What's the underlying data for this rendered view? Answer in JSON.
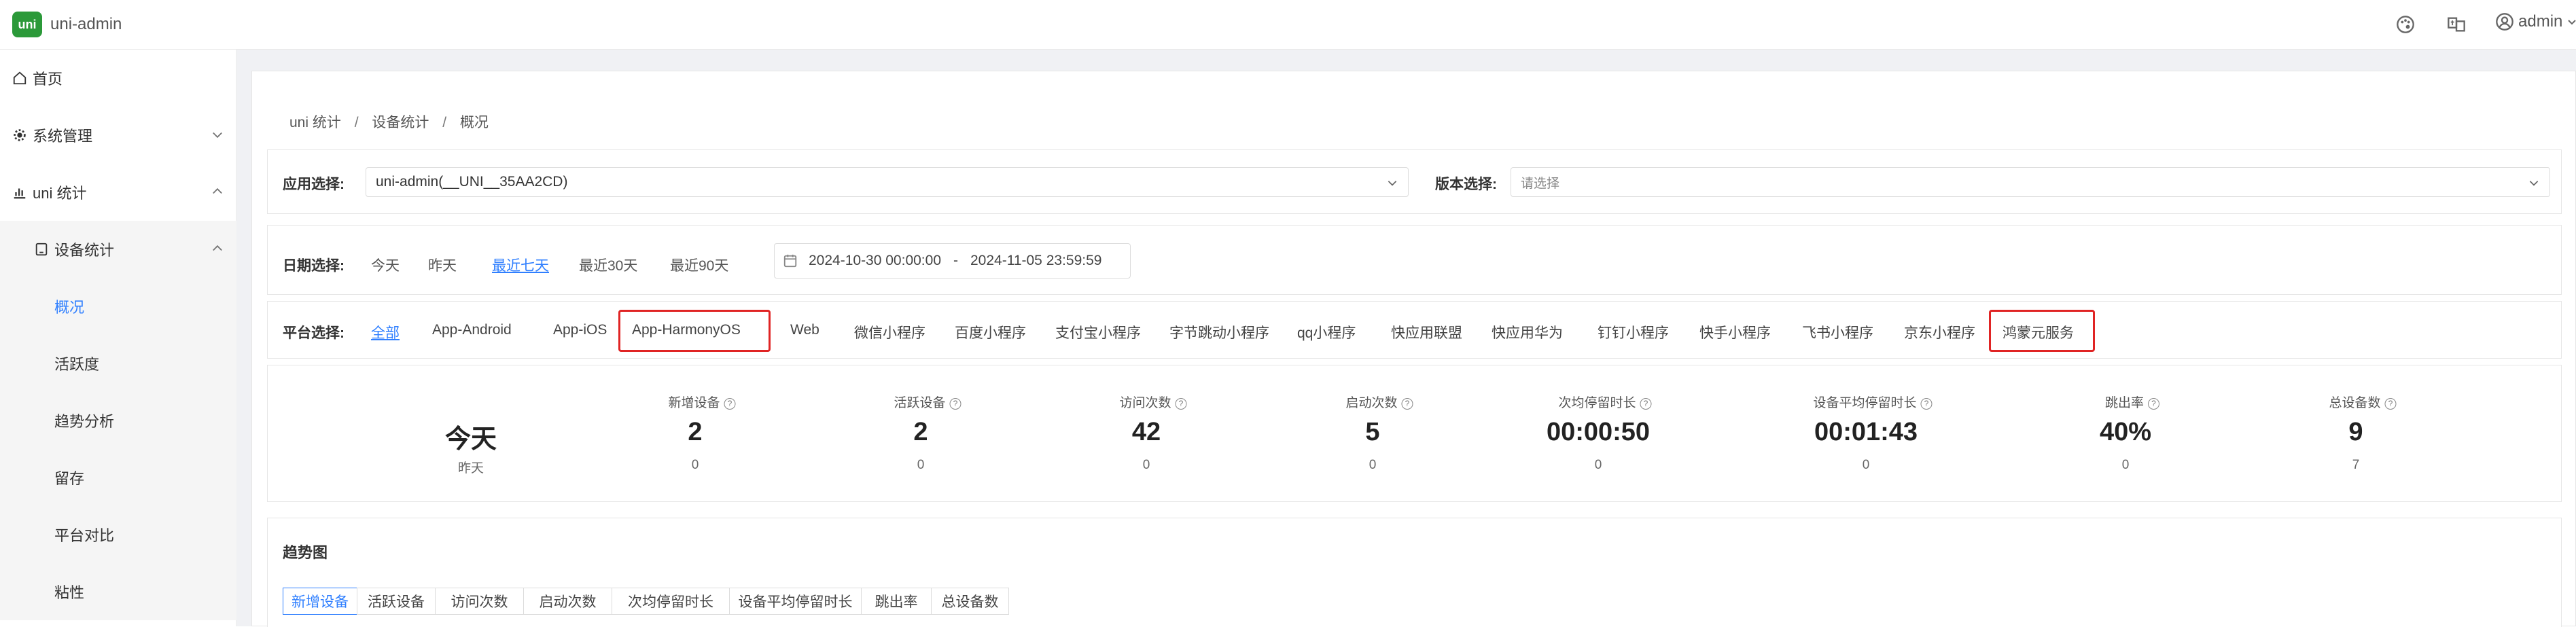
{
  "header": {
    "logo_text": "uni",
    "app_name": "uni-admin",
    "user": "admin"
  },
  "sidebar": {
    "home": "首页",
    "system": "系统管理",
    "uni_stat": "uni 统计",
    "device_stat": "设备统计",
    "leaves": [
      "概况",
      "活跃度",
      "趋势分析",
      "留存",
      "平台对比",
      "粘性"
    ]
  },
  "breadcrumb": [
    "uni 统计",
    "设备统计",
    "概况"
  ],
  "filters": {
    "app_label": "应用选择:",
    "app_value": "uni-admin(__UNI__35AA2CD)",
    "version_label": "版本选择:",
    "version_placeholder": "请选择",
    "date_label": "日期选择:",
    "date_options": [
      "今天",
      "昨天",
      "最近七天",
      "最近30天",
      "最近90天"
    ],
    "date_active": "最近七天",
    "date_start": "2024-10-30 00:00:00",
    "date_sep": "-",
    "date_end": "2024-11-05 23:59:59",
    "platform_label": "平台选择:",
    "platforms": [
      "全部",
      "App-Android",
      "App-iOS",
      "App-HarmonyOS",
      "Web",
      "微信小程序",
      "百度小程序",
      "支付宝小程序",
      "字节跳动小程序",
      "qq小程序",
      "快应用联盟",
      "快应用华为",
      "钉钉小程序",
      "快手小程序",
      "飞书小程序",
      "京东小程序",
      "鸿蒙元服务"
    ],
    "platform_active": "全部",
    "highlighted": [
      "App-HarmonyOS",
      "鸿蒙元服务"
    ]
  },
  "stats": {
    "today_label": "今天",
    "yesterday_label": "昨天",
    "items": [
      {
        "title": "新增设备",
        "today": "2",
        "yesterday": "0"
      },
      {
        "title": "活跃设备",
        "today": "2",
        "yesterday": "0"
      },
      {
        "title": "访问次数",
        "today": "42",
        "yesterday": "0"
      },
      {
        "title": "启动次数",
        "today": "5",
        "yesterday": "0"
      },
      {
        "title": "次均停留时长",
        "today": "00:00:50",
        "yesterday": "0"
      },
      {
        "title": "设备平均停留时长",
        "today": "00:01:43",
        "yesterday": "0"
      },
      {
        "title": "跳出率",
        "today": "40%",
        "yesterday": "0"
      },
      {
        "title": "总设备数",
        "today": "9",
        "yesterday": "7"
      }
    ]
  },
  "trend": {
    "title": "趋势图",
    "tabs": [
      "新增设备",
      "活跃设备",
      "访问次数",
      "启动次数",
      "次均停留时长",
      "设备平均停留时长",
      "跳出率",
      "总设备数"
    ],
    "active_tab": "新增设备"
  },
  "colors": {
    "accent": "#2f7fff",
    "highlight": "#e02424",
    "logo": "#2b9939"
  }
}
